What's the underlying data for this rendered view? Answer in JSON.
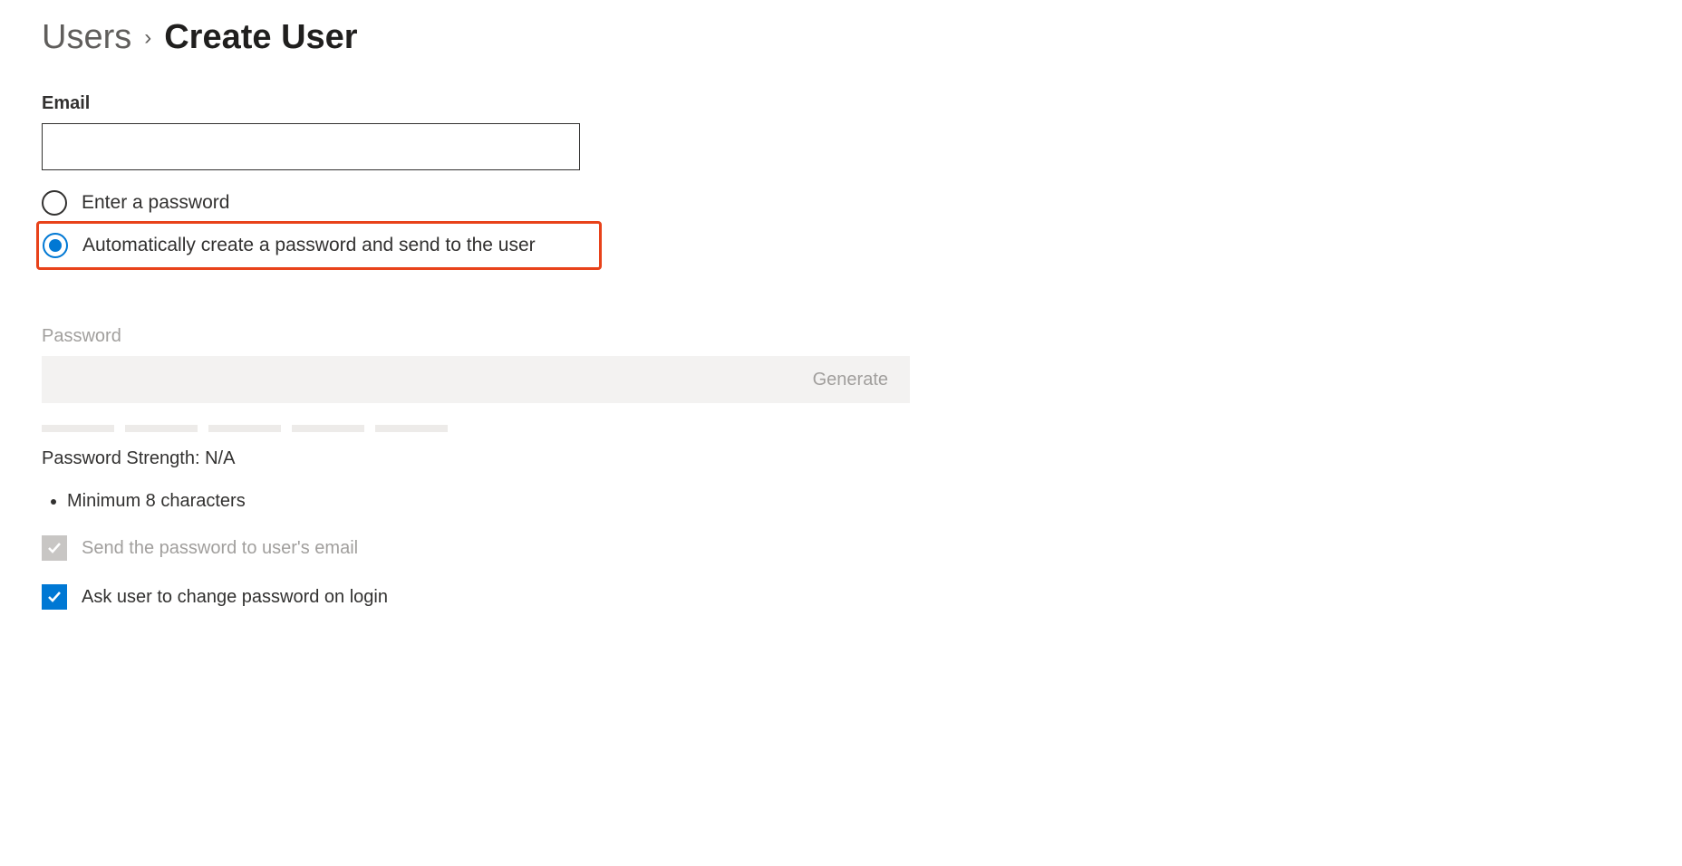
{
  "breadcrumb": {
    "parent": "Users",
    "current": "Create User"
  },
  "email": {
    "label": "Email",
    "value": ""
  },
  "password_mode": {
    "options": [
      {
        "label": "Enter a password",
        "selected": false
      },
      {
        "label": "Automatically create a password and send to the user",
        "selected": true
      }
    ]
  },
  "password": {
    "label": "Password",
    "value": "",
    "generate_label": "Generate",
    "strength_prefix": "Password Strength: ",
    "strength_value": "N/A"
  },
  "requirements": [
    "Minimum 8 characters"
  ],
  "checkboxes": {
    "send_email": {
      "label": "Send the password to user's email",
      "checked": true,
      "disabled": true
    },
    "change_on_login": {
      "label": "Ask user to change password on login",
      "checked": true,
      "disabled": false
    }
  }
}
